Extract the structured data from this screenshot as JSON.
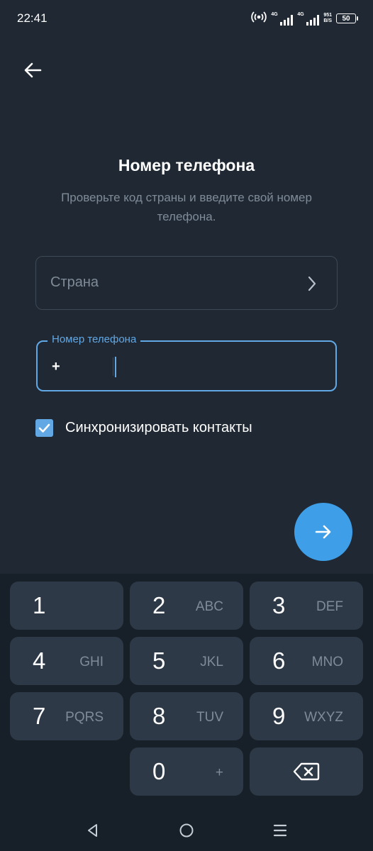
{
  "status_bar": {
    "time": "22:41",
    "net1_label": "4G",
    "net2_label": "4G",
    "speed_value": "951",
    "speed_unit": "B/S",
    "battery": "50",
    "icons": [
      "hotspot-icon",
      "signal-icon",
      "signal-icon",
      "battery-icon"
    ]
  },
  "header": {
    "back_icon": "arrow-left-icon",
    "title": "Номер телефона",
    "subtitle": "Проверьте код страны и введите свой номер телефона."
  },
  "form": {
    "country_placeholder": "Страна",
    "country_icon": "chevron-right-icon",
    "phone_label": "Номер телефона",
    "phone_prefix": "+",
    "phone_value": "",
    "sync_checked": true,
    "sync_label": "Синхронизировать контакты"
  },
  "next_button": {
    "icon": "arrow-right-icon"
  },
  "keypad": {
    "keys": [
      {
        "num": "1",
        "letters": ""
      },
      {
        "num": "2",
        "letters": "ABC"
      },
      {
        "num": "3",
        "letters": "DEF"
      },
      {
        "num": "4",
        "letters": "GHI"
      },
      {
        "num": "5",
        "letters": "JKL"
      },
      {
        "num": "6",
        "letters": "MNO"
      },
      {
        "num": "7",
        "letters": "PQRS"
      },
      {
        "num": "8",
        "letters": "TUV"
      },
      {
        "num": "9",
        "letters": "WXYZ"
      },
      {
        "num": "0",
        "letters": "+"
      }
    ],
    "backspace_icon": "backspace-icon"
  },
  "nav_bar": {
    "icons": [
      "back-triangle-icon",
      "home-circle-icon",
      "recents-menu-icon"
    ]
  },
  "colors": {
    "background": "#1f2833",
    "keypad_background": "#171f28",
    "key": "#2d3947",
    "accent": "#62a8e4",
    "fab": "#3e9ee8",
    "muted_text": "#7f8b98",
    "border": "#3d4957"
  }
}
